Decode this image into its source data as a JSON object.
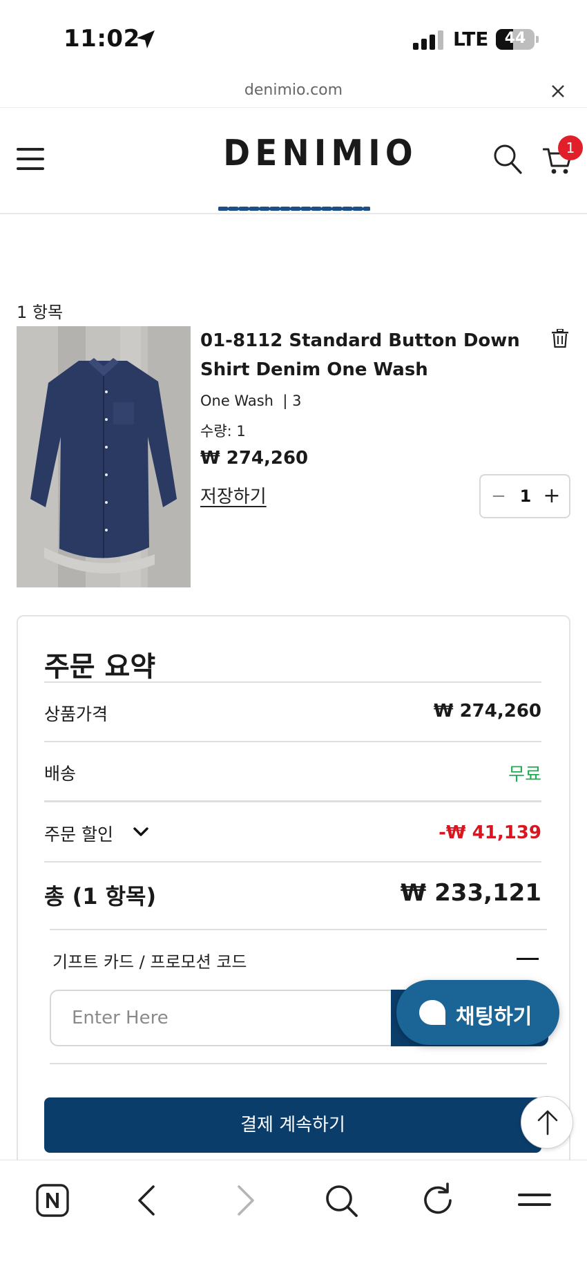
{
  "status_bar": {
    "time": "11:02",
    "network": "LTE",
    "battery": "44",
    "battery_level_percent": 44,
    "icons": [
      "location-arrow-icon",
      "signal-bars-icon",
      "battery-icon"
    ]
  },
  "browser": {
    "url": "denimio.com",
    "close_icon": "close-icon"
  },
  "header": {
    "logo": "DENIMIO",
    "menu_icon": "hamburger-menu-icon",
    "search_icon": "search-icon",
    "cart_icon": "cart-icon",
    "cart_count": "1",
    "badge_color": "#e01f2a"
  },
  "cart": {
    "item_count_label": "1 항목",
    "item": {
      "title": "01-8112 Standard Button Down Shirt Denim One Wash",
      "variant": "One Wash  | 3",
      "quantity_label": "수량: 1",
      "price": "₩ 274,260",
      "save_label": "저장하기",
      "stepper_minus": "−",
      "stepper_value": "1",
      "stepper_plus": "+"
    }
  },
  "summary": {
    "title": "주문 요약",
    "rows": [
      {
        "label": "상품가격",
        "value": "₩ 274,260"
      },
      {
        "label": "배송",
        "value": "무료"
      },
      {
        "label": "주문 할인",
        "value": "-₩ 41,139"
      }
    ],
    "total_label": "총 (1 항목)",
    "total_value": "₩ 233,121",
    "promo_label": "기프트 카드 / 프로모션 코드",
    "promo_placeholder": "Enter Here",
    "chat_label": "채팅하기",
    "checkout_label": "결제 계속하기"
  },
  "colors": {
    "primary": "#0b3d6b",
    "chat": "#1b6496",
    "free": "#1eae52",
    "discount": "#d9151f"
  },
  "toolbar": {
    "icons": [
      "naver-home-icon",
      "back-icon",
      "forward-icon",
      "search-icon",
      "reload-icon",
      "menu-icon"
    ]
  }
}
